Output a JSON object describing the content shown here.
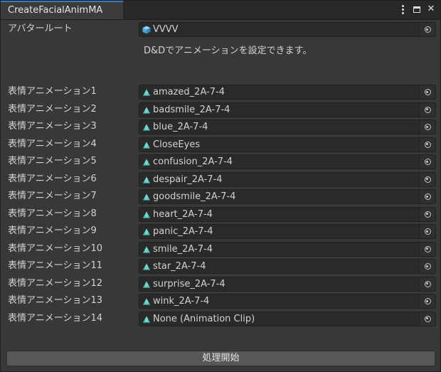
{
  "window": {
    "tab_title": "CreateFacialAnimMA",
    "menu_icon": "vertical-dots-icon",
    "maximize_icon": "maximize-icon",
    "close_icon": "close-icon"
  },
  "avatar_root": {
    "label": "アバタールート",
    "value": "VVVV",
    "icon": "prefab-cube-icon",
    "icon_color": "#5fb8e8"
  },
  "help_text": "D&Dでアニメーションを設定できます。",
  "animation_clip_icon_color": "#4fc9c0",
  "animations": [
    {
      "label": "表情アニメーション1",
      "value": "amazed_2A-7-4"
    },
    {
      "label": "表情アニメーション2",
      "value": "badsmile_2A-7-4"
    },
    {
      "label": "表情アニメーション3",
      "value": "blue_2A-7-4"
    },
    {
      "label": "表情アニメーション4",
      "value": "CloseEyes"
    },
    {
      "label": "表情アニメーション5",
      "value": "confusion_2A-7-4"
    },
    {
      "label": "表情アニメーション6",
      "value": "despair_2A-7-4"
    },
    {
      "label": "表情アニメーション7",
      "value": "goodsmile_2A-7-4"
    },
    {
      "label": "表情アニメーション8",
      "value": "heart_2A-7-4"
    },
    {
      "label": "表情アニメーション9",
      "value": "panic_2A-7-4"
    },
    {
      "label": "表情アニメーション10",
      "value": "smile_2A-7-4"
    },
    {
      "label": "表情アニメーション11",
      "value": "star_2A-7-4"
    },
    {
      "label": "表情アニメーション12",
      "value": "surprise_2A-7-4"
    },
    {
      "label": "表情アニメーション13",
      "value": "wink_2A-7-4"
    },
    {
      "label": "表情アニメーション14",
      "value": "None (Animation Clip)"
    }
  ],
  "process_button": "処理開始"
}
